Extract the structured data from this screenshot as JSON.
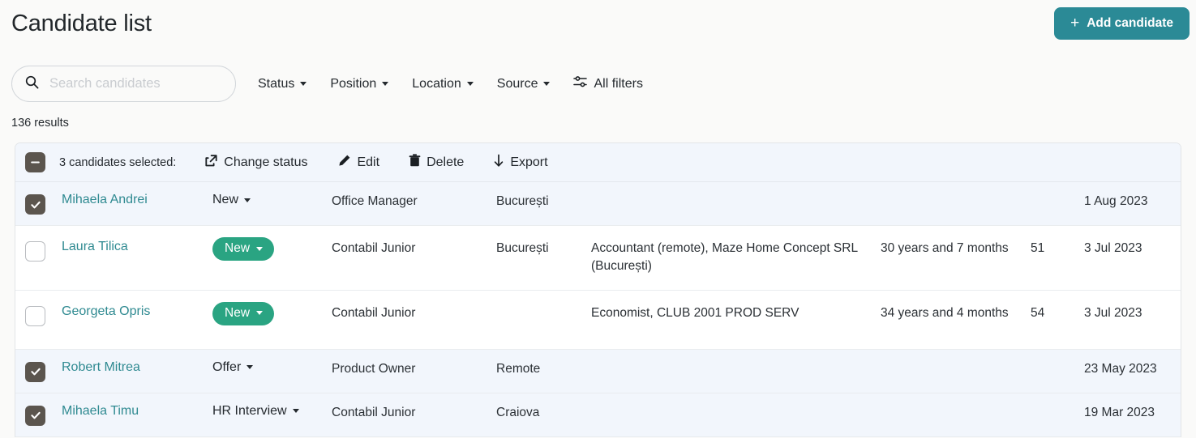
{
  "header": {
    "title": "Candidate list",
    "add_button": {
      "label": "Add candidate",
      "icon": "plus-icon"
    },
    "accent_color": "#2b8a96"
  },
  "search": {
    "value": "",
    "placeholder": "Search candidates",
    "icon": "search-icon"
  },
  "filters": [
    {
      "label": "Status",
      "icon": "chevron-down-icon"
    },
    {
      "label": "Position",
      "icon": "chevron-down-icon"
    },
    {
      "label": "Location",
      "icon": "chevron-down-icon"
    },
    {
      "label": "Source",
      "icon": "chevron-down-icon"
    }
  ],
  "all_filters": {
    "label": "All filters",
    "icon": "sliders-icon"
  },
  "results": {
    "count_text": "136 results"
  },
  "bulk_bar": {
    "select_all_state": "indeterminate",
    "selected_label": "3 candidates selected:",
    "actions": [
      {
        "label": "Change status",
        "icon": "share-icon"
      },
      {
        "label": "Edit",
        "icon": "pencil-icon"
      },
      {
        "label": "Delete",
        "icon": "trash-icon"
      },
      {
        "label": "Export",
        "icon": "download-arrow-icon"
      }
    ]
  },
  "colors": {
    "link": "#2f8a91",
    "badge_green": "#2aa482",
    "checkbox": "#5b554e",
    "selected_row": "#f2f6fc"
  },
  "rows": [
    {
      "selected": true,
      "name": "Mihaela Andrei",
      "status": "New",
      "status_style": "plain",
      "position": "Office Manager",
      "location": "București",
      "experience": "",
      "age": "",
      "score": "",
      "date": "1 Aug 2023"
    },
    {
      "selected": false,
      "name": "Laura Tilica",
      "status": "New",
      "status_style": "badge",
      "position": "Contabil Junior",
      "location": "București",
      "experience": "Accountant (remote), Maze Home Concept SRL (București)",
      "age": "30 years and 7 months",
      "score": "51",
      "date": "3 Jul 2023"
    },
    {
      "selected": false,
      "name": "Georgeta Opris",
      "status": "New",
      "status_style": "badge",
      "position": "Contabil Junior",
      "location": "",
      "experience": "Economist, CLUB 2001 PROD SERV",
      "age": "34 years and 4 months",
      "score": "54",
      "date": "3 Jul 2023"
    },
    {
      "selected": true,
      "name": "Robert Mitrea",
      "status": "Offer",
      "status_style": "plain",
      "position": "Product Owner",
      "location": "Remote",
      "experience": "",
      "age": "",
      "score": "",
      "date": "23 May 2023"
    },
    {
      "selected": true,
      "name": "Mihaela Timu",
      "status": "HR Interview",
      "status_style": "plain",
      "position": "Contabil Junior",
      "location": "Craiova",
      "experience": "",
      "age": "",
      "score": "",
      "date": "19 Mar 2023"
    }
  ]
}
